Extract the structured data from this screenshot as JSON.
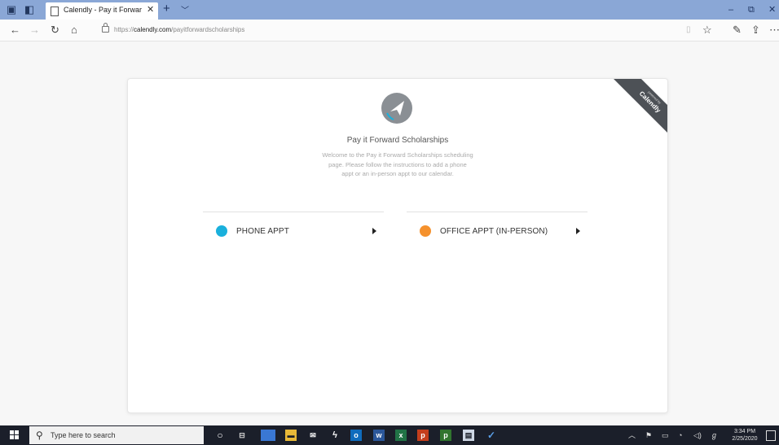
{
  "browser": {
    "tab_title": "Calendly - Pay it Forwar",
    "url_prefix": "https://",
    "url_domain": "calendly.com",
    "url_path": "/payitforwardscholarships"
  },
  "ribbon": {
    "small_text": "powered by",
    "brand": "Calendly"
  },
  "page": {
    "title": "Pay it Forward Scholarships",
    "description": "Welcome to the Pay it Forward Scholarships scheduling page. Please follow the instructions to add a phone appt or an in-person appt to our calendar.",
    "options": [
      {
        "label": "PHONE APPT",
        "color": "#1ab0dc"
      },
      {
        "label": "OFFICE APPT (IN-PERSON)",
        "color": "#f5912d"
      }
    ]
  },
  "taskbar": {
    "search_placeholder": "Type here to search",
    "time": "3:34 PM",
    "date": "2/25/2020"
  },
  "colors": {
    "titlebar": "#8aa7d6",
    "taskbar": "#1b1f2a",
    "logo": "#8a8f94",
    "logo_accent": "#1ab0dc"
  }
}
